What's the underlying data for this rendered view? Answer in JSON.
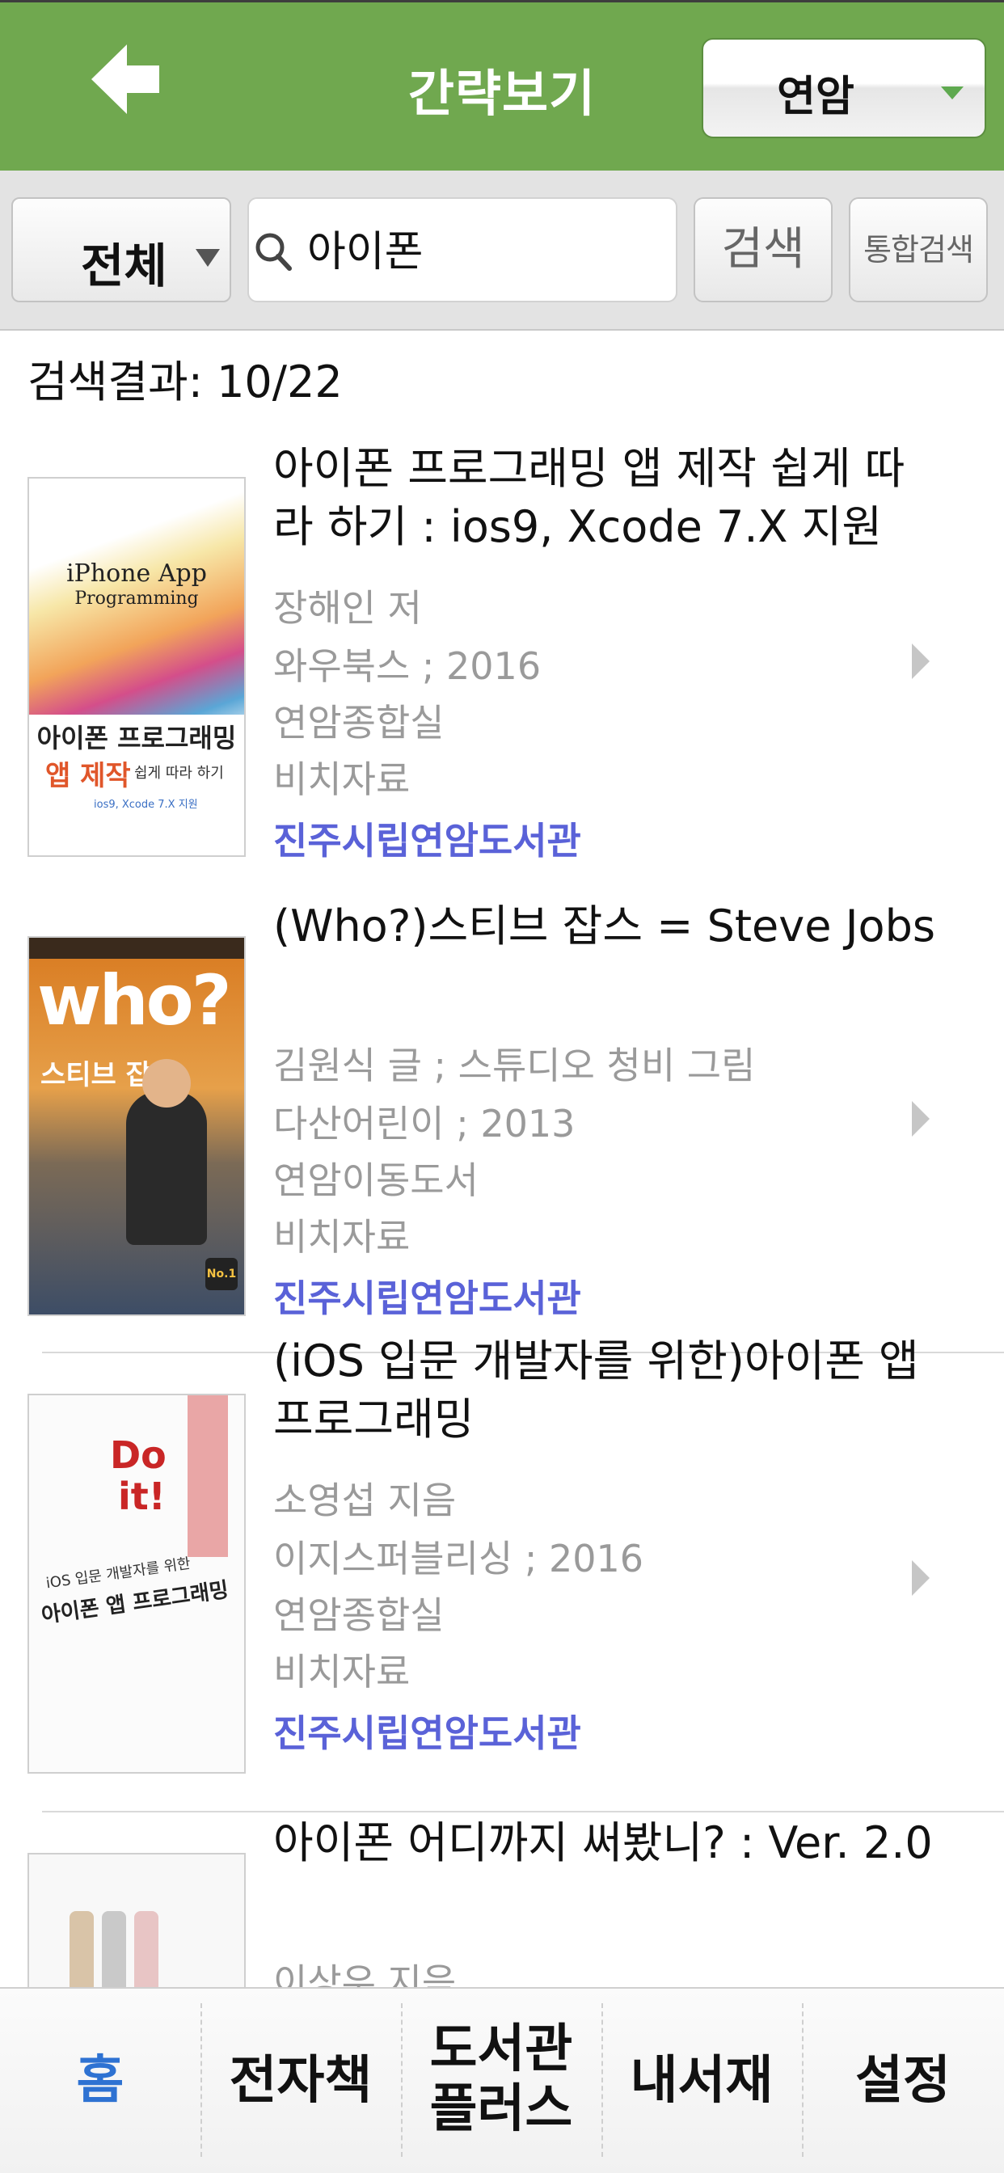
{
  "header": {
    "title": "간략보기",
    "library_select": "연암",
    "accent": "#70a84f"
  },
  "search": {
    "scope": "전체",
    "query": "아이폰",
    "search_button": "검색",
    "total_search_button": "통합검색"
  },
  "result_count": "검색결과: 10/22",
  "items": [
    {
      "title": "아이폰 프로그래밍 앱 제작 쉽게 따라 하기 : ios9, Xcode 7.X 지원",
      "author": "장해인 저",
      "publisher": "와우북스 ; 2016",
      "location": "연암종합실",
      "type": "비치자료",
      "library": "진주시립연암도서관",
      "cover": {
        "line1": "iPhone App",
        "line2": "Programming",
        "line3": "아이폰 프로그래밍",
        "line4": "앱 제작",
        "line5": "쉽게 따라 하기",
        "line6": "ios9, Xcode 7.X 지원"
      }
    },
    {
      "title": "(Who?)스티브 잡스 = Steve Jobs",
      "author": "김원식 글 ; 스튜디오 청비 그림",
      "publisher": "다산어린이 ; 2013",
      "location": "연암이동도서",
      "type": "비치자료",
      "library": "진주시립연암도서관",
      "cover": {
        "line1": "who?",
        "line2": "스티브 잡스",
        "line3": "No.1"
      }
    },
    {
      "title": "(iOS 입문 개발자를 위한)아이폰 앱 프로그래밍",
      "author": "소영섭 지음",
      "publisher": "이지스퍼블리싱 ; 2016",
      "location": "연암종합실",
      "type": "비치자료",
      "library": "진주시립연암도서관",
      "cover": {
        "line1": "Do",
        "line2": "it!",
        "line3": "iOS 입문 개발자를 위한",
        "line4": "아이폰 앱 프로그래밍"
      }
    },
    {
      "title": "아이폰 어디까지 써봤니? : Ver. 2.0",
      "author": "이상우 지음"
    }
  ],
  "tabs": [
    "홈",
    "전자책",
    "도서관 플러스",
    "내서재",
    "설정"
  ],
  "tab_lines": {
    "library_plus": [
      "도서관",
      "플러스"
    ]
  }
}
